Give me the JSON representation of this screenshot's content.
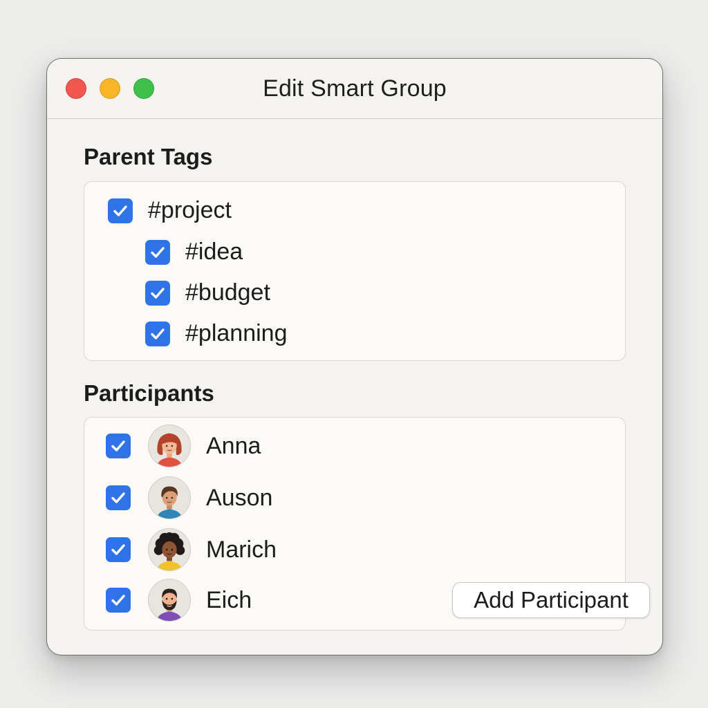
{
  "window": {
    "title": "Edit Smart Group",
    "controls": [
      {
        "name": "close",
        "color": "#f2574f"
      },
      {
        "name": "minimize",
        "color": "#f8b527"
      },
      {
        "name": "zoom",
        "color": "#3fc04b"
      }
    ]
  },
  "parent_tags": {
    "heading": "Parent Tags",
    "items": [
      {
        "label": "#project",
        "checked": true,
        "level": 0
      },
      {
        "label": "#idea",
        "checked": true,
        "level": 1
      },
      {
        "label": "#budget",
        "checked": true,
        "level": 1
      },
      {
        "label": "#planning",
        "checked": true,
        "level": 1
      }
    ]
  },
  "participants": {
    "heading": "Participants",
    "items": [
      {
        "name": "Anna",
        "checked": true,
        "avatar": "woman-red-hair-avatar"
      },
      {
        "name": "Auson",
        "checked": true,
        "avatar": "man-brown-hair-avatar"
      },
      {
        "name": "Marich",
        "checked": true,
        "avatar": "woman-curly-hair-avatar"
      },
      {
        "name": "Eich",
        "checked": true,
        "avatar": "man-beard-avatar"
      }
    ],
    "add_button_label": "Add Participant"
  },
  "colors": {
    "accent": "#2e73e7",
    "window_background": "#f4f3f0",
    "panel_background": "#fbfaf7"
  }
}
